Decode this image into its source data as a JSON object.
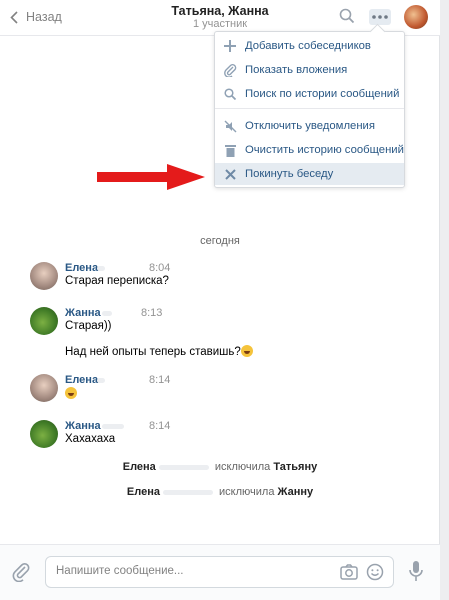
{
  "header": {
    "back_label": "Назад",
    "title": "Татьяна, Жанна",
    "subtitle": "1 участник"
  },
  "menu": {
    "items": [
      {
        "label": "Добавить собеседников",
        "icon": "plus-icon"
      },
      {
        "label": "Показать вложения",
        "icon": "paperclip-icon"
      },
      {
        "label": "Поиск по истории сообщений",
        "icon": "search-icon"
      },
      {
        "label": "Отключить уведомления",
        "icon": "mute-icon"
      },
      {
        "label": "Очистить историю сообщений",
        "icon": "trash-icon"
      },
      {
        "label": "Покинуть беседу",
        "icon": "close-icon"
      }
    ]
  },
  "chat": {
    "date": "сегодня",
    "messages": [
      {
        "author": "Елена",
        "time": "8:04",
        "text": "Старая переписка?"
      },
      {
        "author": "Жанна",
        "time": "8:13",
        "text": "Старая))",
        "text2": "Над ней опыты теперь ставишь?"
      },
      {
        "author": "Елена",
        "time": "8:14",
        "text": ""
      },
      {
        "author": "Жанна",
        "time": "8:14",
        "text": "Хахахаха"
      }
    ],
    "system": [
      {
        "actor": "Елена",
        "action": "исключила",
        "target": "Татьяну"
      },
      {
        "actor": "Елена",
        "action": "исключила",
        "target": "Жанну"
      }
    ]
  },
  "composer": {
    "placeholder": "Напишите сообщение..."
  },
  "colors": {
    "link": "#2a5885",
    "arrow": "#e41b1b",
    "active_menu": "#e5ebf1"
  }
}
